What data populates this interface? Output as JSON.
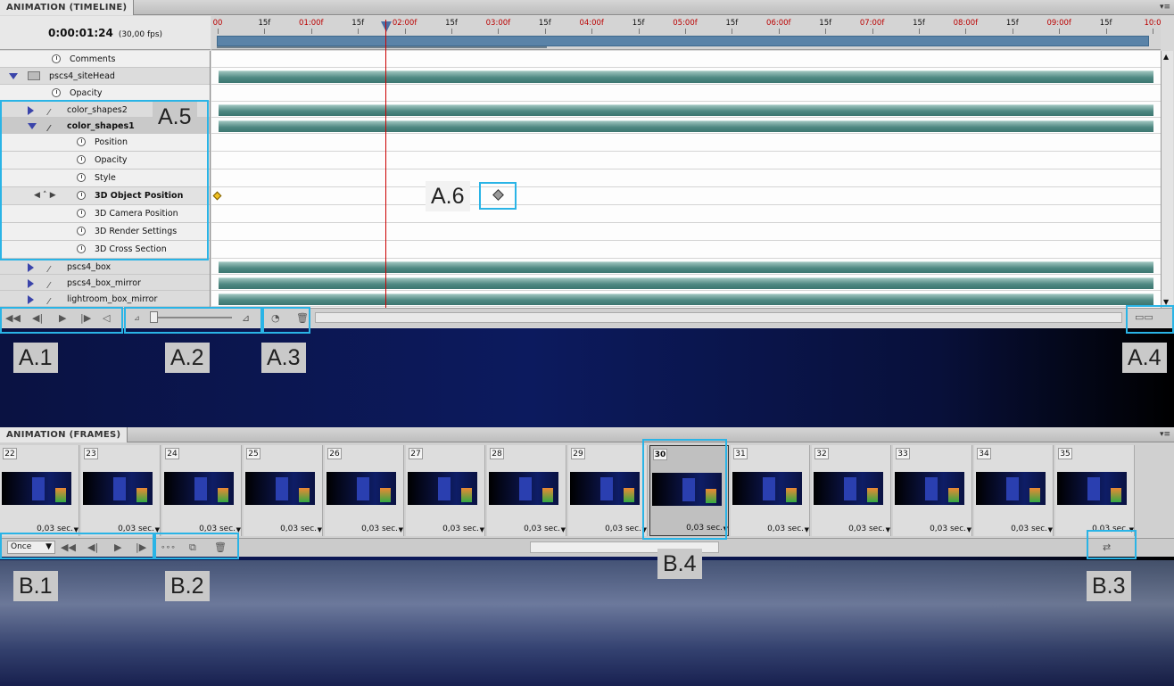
{
  "timeline": {
    "title": "ANIMATION (TIMELINE)",
    "timecode": "0:00:01:24",
    "fps": "(30,00 fps)",
    "ruler_labels": [
      {
        "t": "00",
        "red": true
      },
      {
        "t": "15f",
        "red": false
      },
      {
        "t": "01:00f",
        "red": true
      },
      {
        "t": "15f",
        "red": false
      },
      {
        "t": "02:00f",
        "red": true
      },
      {
        "t": "15f",
        "red": false
      },
      {
        "t": "03:00f",
        "red": true
      },
      {
        "t": "15f",
        "red": false
      },
      {
        "t": "04:00f",
        "red": true
      },
      {
        "t": "15f",
        "red": false
      },
      {
        "t": "05:00f",
        "red": true
      },
      {
        "t": "15f",
        "red": false
      },
      {
        "t": "06:00f",
        "red": true
      },
      {
        "t": "15f",
        "red": false
      },
      {
        "t": "07:00f",
        "red": true
      },
      {
        "t": "15f",
        "red": false
      },
      {
        "t": "08:00f",
        "red": true
      },
      {
        "t": "15f",
        "red": false
      },
      {
        "t": "09:00f",
        "red": true
      },
      {
        "t": "15f",
        "red": false
      },
      {
        "t": "10:0",
        "red": true
      }
    ],
    "layers": [
      {
        "label": "Comments",
        "kind": "prop",
        "indent": 1
      },
      {
        "label": "pscs4_siteHead",
        "kind": "group",
        "expanded": true
      },
      {
        "label": "Opacity",
        "kind": "prop",
        "indent": 1
      },
      {
        "label": "color_shapes2",
        "kind": "layer",
        "expanded": false
      },
      {
        "label": "color_shapes1",
        "kind": "layer",
        "expanded": true,
        "selected": true
      },
      {
        "label": "Position",
        "kind": "prop",
        "indent": 2
      },
      {
        "label": "Opacity",
        "kind": "prop",
        "indent": 2
      },
      {
        "label": "Style",
        "kind": "prop",
        "indent": 2
      },
      {
        "label": "3D Object Position",
        "kind": "prop",
        "indent": 2,
        "active": true
      },
      {
        "label": "3D Camera Position",
        "kind": "prop",
        "indent": 2
      },
      {
        "label": "3D Render Settings",
        "kind": "prop",
        "indent": 2
      },
      {
        "label": "3D Cross Section",
        "kind": "prop",
        "indent": 2
      },
      {
        "label": "pscs4_box",
        "kind": "layer",
        "expanded": false
      },
      {
        "label": "pscs4_box_mirror",
        "kind": "layer",
        "expanded": false
      },
      {
        "label": "lightroom_box_mirror",
        "kind": "layer",
        "expanded": false
      }
    ]
  },
  "frames": {
    "title": "ANIMATION (FRAMES)",
    "loop": "Once",
    "items": [
      {
        "n": "22",
        "delay": "0,03 sec."
      },
      {
        "n": "23",
        "delay": "0,03 sec."
      },
      {
        "n": "24",
        "delay": "0,03 sec."
      },
      {
        "n": "25",
        "delay": "0,03 sec."
      },
      {
        "n": "26",
        "delay": "0,03 sec."
      },
      {
        "n": "27",
        "delay": "0,03 sec."
      },
      {
        "n": "28",
        "delay": "0,03 sec."
      },
      {
        "n": "29",
        "delay": "0,03 sec."
      },
      {
        "n": "30",
        "delay": "0,03 sec."
      },
      {
        "n": "31",
        "delay": "0,03 sec."
      },
      {
        "n": "32",
        "delay": "0,03 sec."
      },
      {
        "n": "33",
        "delay": "0,03 sec."
      },
      {
        "n": "34",
        "delay": "0,03 sec."
      },
      {
        "n": "35",
        "delay": "0,03 sec."
      }
    ],
    "current": "30"
  },
  "annotations": {
    "a1": "A.1",
    "a2": "A.2",
    "a3": "A.3",
    "a4": "A.4",
    "a5": "A.5",
    "a6": "A.6",
    "b1": "B.1",
    "b2": "B.2",
    "b3": "B.3",
    "b4": "B.4"
  },
  "colors": {
    "highlight": "#2ab4e6",
    "track": "#4e8882",
    "playhead": "#cc0000",
    "background": "#0c1a5e"
  }
}
